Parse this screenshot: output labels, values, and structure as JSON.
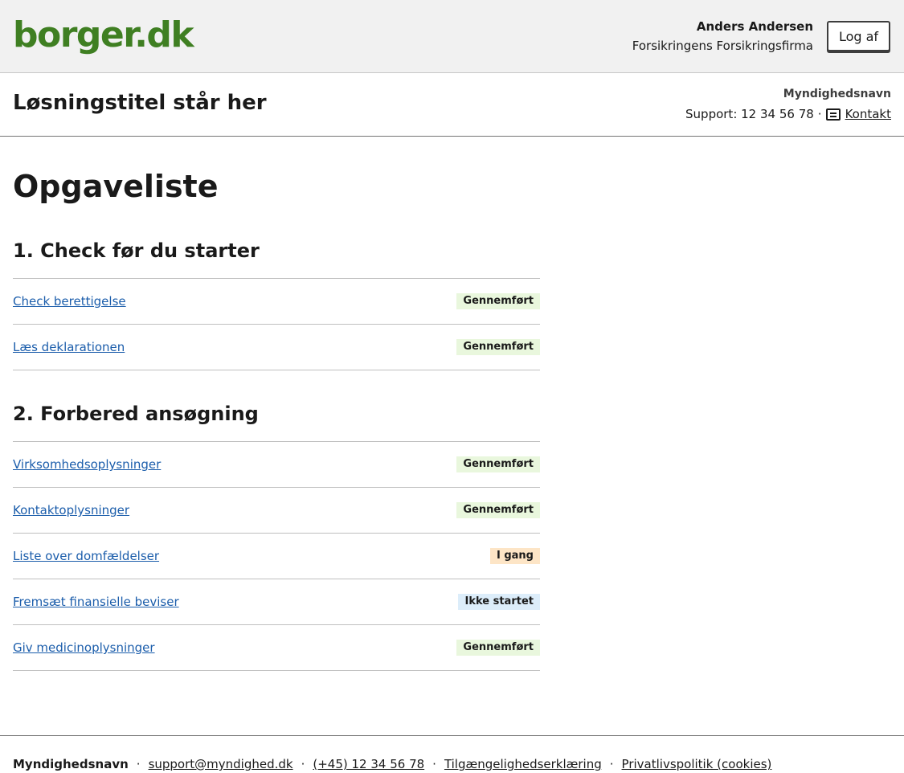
{
  "portal": {
    "logo": "borger.dk",
    "user_name": "Anders Andersen",
    "user_org": "Forsikringens Forsikringsfirma",
    "logout_label": "Log af"
  },
  "solution": {
    "title": "Løsningstitel står her",
    "authority": "Myndighedsnavn",
    "support_text": "Support: 12 34 56 78",
    "separator": "·",
    "contact_label": "Kontakt",
    "contact_icon": "message-icon"
  },
  "page": {
    "title": "Opgaveliste"
  },
  "sections": [
    {
      "heading": "1. Check før du starter",
      "tasks": [
        {
          "label": "Check berettigelse",
          "status": "Gennemført"
        },
        {
          "label": "Læs deklarationen",
          "status": "Gennemført"
        }
      ]
    },
    {
      "heading": "2. Forbered ansøgning",
      "tasks": [
        {
          "label": "Virksomhedsoplysninger",
          "status": "Gennemført"
        },
        {
          "label": "Kontaktoplysninger",
          "status": "Gennemført"
        },
        {
          "label": "Liste over domfældelser",
          "status": "I gang"
        },
        {
          "label": "Fremsæt finansielle beviser",
          "status": "Ikke startet"
        },
        {
          "label": "Giv medicinoplysninger",
          "status": "Gennemført"
        }
      ]
    }
  ],
  "colors": {
    "brand_green": "#3f7f22",
    "link_blue": "#1b5dab",
    "status_done_bg": "#e9f7dd",
    "status_progress_bg": "#fde5c6",
    "status_notstarted_bg": "#dcedfa"
  },
  "footer": {
    "authority": "Myndighedsnavn",
    "separator": "·",
    "email": "support@myndighed.dk",
    "phone": "(+45) 12 34 56 78",
    "accessibility": "Tilgængelighedserklæring",
    "privacy": "Privatlivspolitik (cookies)"
  }
}
